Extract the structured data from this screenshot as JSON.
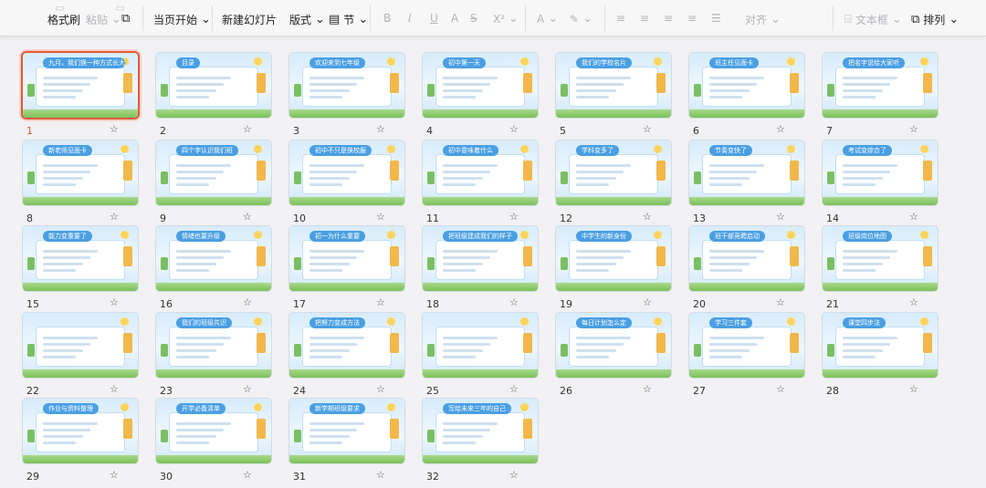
{
  "toolbar": {
    "format_painter": "格式刷",
    "paste": "粘贴",
    "from_current": "当页开始",
    "new_slide": "新建幻灯片",
    "layout": "版式",
    "section": "节",
    "align": "对齐",
    "textbox": "文本框",
    "arrange": "排列"
  },
  "slides": [
    {
      "num": "1",
      "title": "九月，我们换一种方式长大"
    },
    {
      "num": "2",
      "title": "目录"
    },
    {
      "num": "3",
      "title": "欢迎来到七年级"
    },
    {
      "num": "4",
      "title": "初中第一天"
    },
    {
      "num": "5",
      "title": "我们的学校名片"
    },
    {
      "num": "6",
      "title": "班主任见面卡"
    },
    {
      "num": "7",
      "title": "把名字说给大家听"
    },
    {
      "num": "8",
      "title": "新老师见面卡"
    },
    {
      "num": "9",
      "title": "四个字认识我们班"
    },
    {
      "num": "10",
      "title": "初中不只是换校服"
    },
    {
      "num": "11",
      "title": "初中意味着什么"
    },
    {
      "num": "12",
      "title": "学科变多了"
    },
    {
      "num": "13",
      "title": "节奏变快了"
    },
    {
      "num": "14",
      "title": "考试变综合了"
    },
    {
      "num": "15",
      "title": "能力变重要了"
    },
    {
      "num": "16",
      "title": "情绪也要升级"
    },
    {
      "num": "17",
      "title": "初一为什么重要"
    },
    {
      "num": "18",
      "title": "把班级建成我们的样子"
    },
    {
      "num": "19",
      "title": "中学生的新身份"
    },
    {
      "num": "20",
      "title": "班干部竞聘启动"
    },
    {
      "num": "21",
      "title": "班级岗位地图"
    },
    {
      "num": "22",
      "title": ""
    },
    {
      "num": "23",
      "title": "我们的班级共识"
    },
    {
      "num": "24",
      "title": "把努力变成方法"
    },
    {
      "num": "25",
      "title": ""
    },
    {
      "num": "26",
      "title": "每日计划怎么定"
    },
    {
      "num": "27",
      "title": "学习三件套"
    },
    {
      "num": "28",
      "title": "课堂四步法"
    },
    {
      "num": "29",
      "title": "作业与资料整理"
    },
    {
      "num": "30",
      "title": "开学必备清单"
    },
    {
      "num": "31",
      "title": "新学期班级要求"
    },
    {
      "num": "32",
      "title": "写给未来三年的自己"
    }
  ],
  "selected_slide": "1",
  "colors": {
    "accent": "#e2593b",
    "title_blue": "#4a9fe3"
  }
}
